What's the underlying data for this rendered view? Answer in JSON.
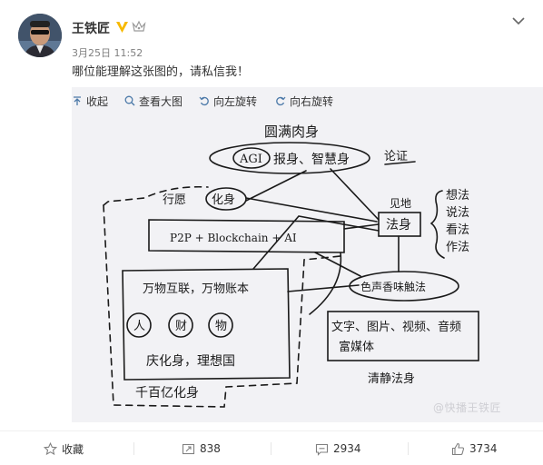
{
  "post": {
    "username": "王铁匠",
    "time": "3月25日 11:52",
    "text": "哪位能理解这张图的，请私信我！"
  },
  "toolbar": {
    "collapse": "收起",
    "view_large": "查看大图",
    "rotate_left": "向左旋转",
    "rotate_right": "向右旋转"
  },
  "sketch": {
    "top_title": "圆满肉身",
    "agi": "AGI",
    "agi_right": "报身、智慧身",
    "verify": "论证",
    "xingyin": "行愿",
    "huashen": "化身",
    "p2p": "P2P + Blockchain + AI",
    "jiandi": "见地",
    "fashen": "法身",
    "list_1": "想法",
    "list_2": "说法",
    "list_3": "看法",
    "list_4": "作法",
    "color_sound": "色声香味触法",
    "media": "文字、图片、视频、音频",
    "media_2": "富媒体",
    "wanwu": "万物互联，万物账本",
    "ren": "人",
    "cai": "财",
    "wu": "物",
    "ideal": "庆化身，理想国",
    "qingjing": "清静法身",
    "qianbai": "千百亿化身"
  },
  "watermark": "@快播王铁匠",
  "footer": {
    "favorite": "收藏",
    "repost": "838",
    "comment": "2934",
    "like": "3734"
  },
  "colors": {
    "accent": "#eb7350",
    "verified": "#f7b900",
    "icon_gray": "#808080"
  }
}
